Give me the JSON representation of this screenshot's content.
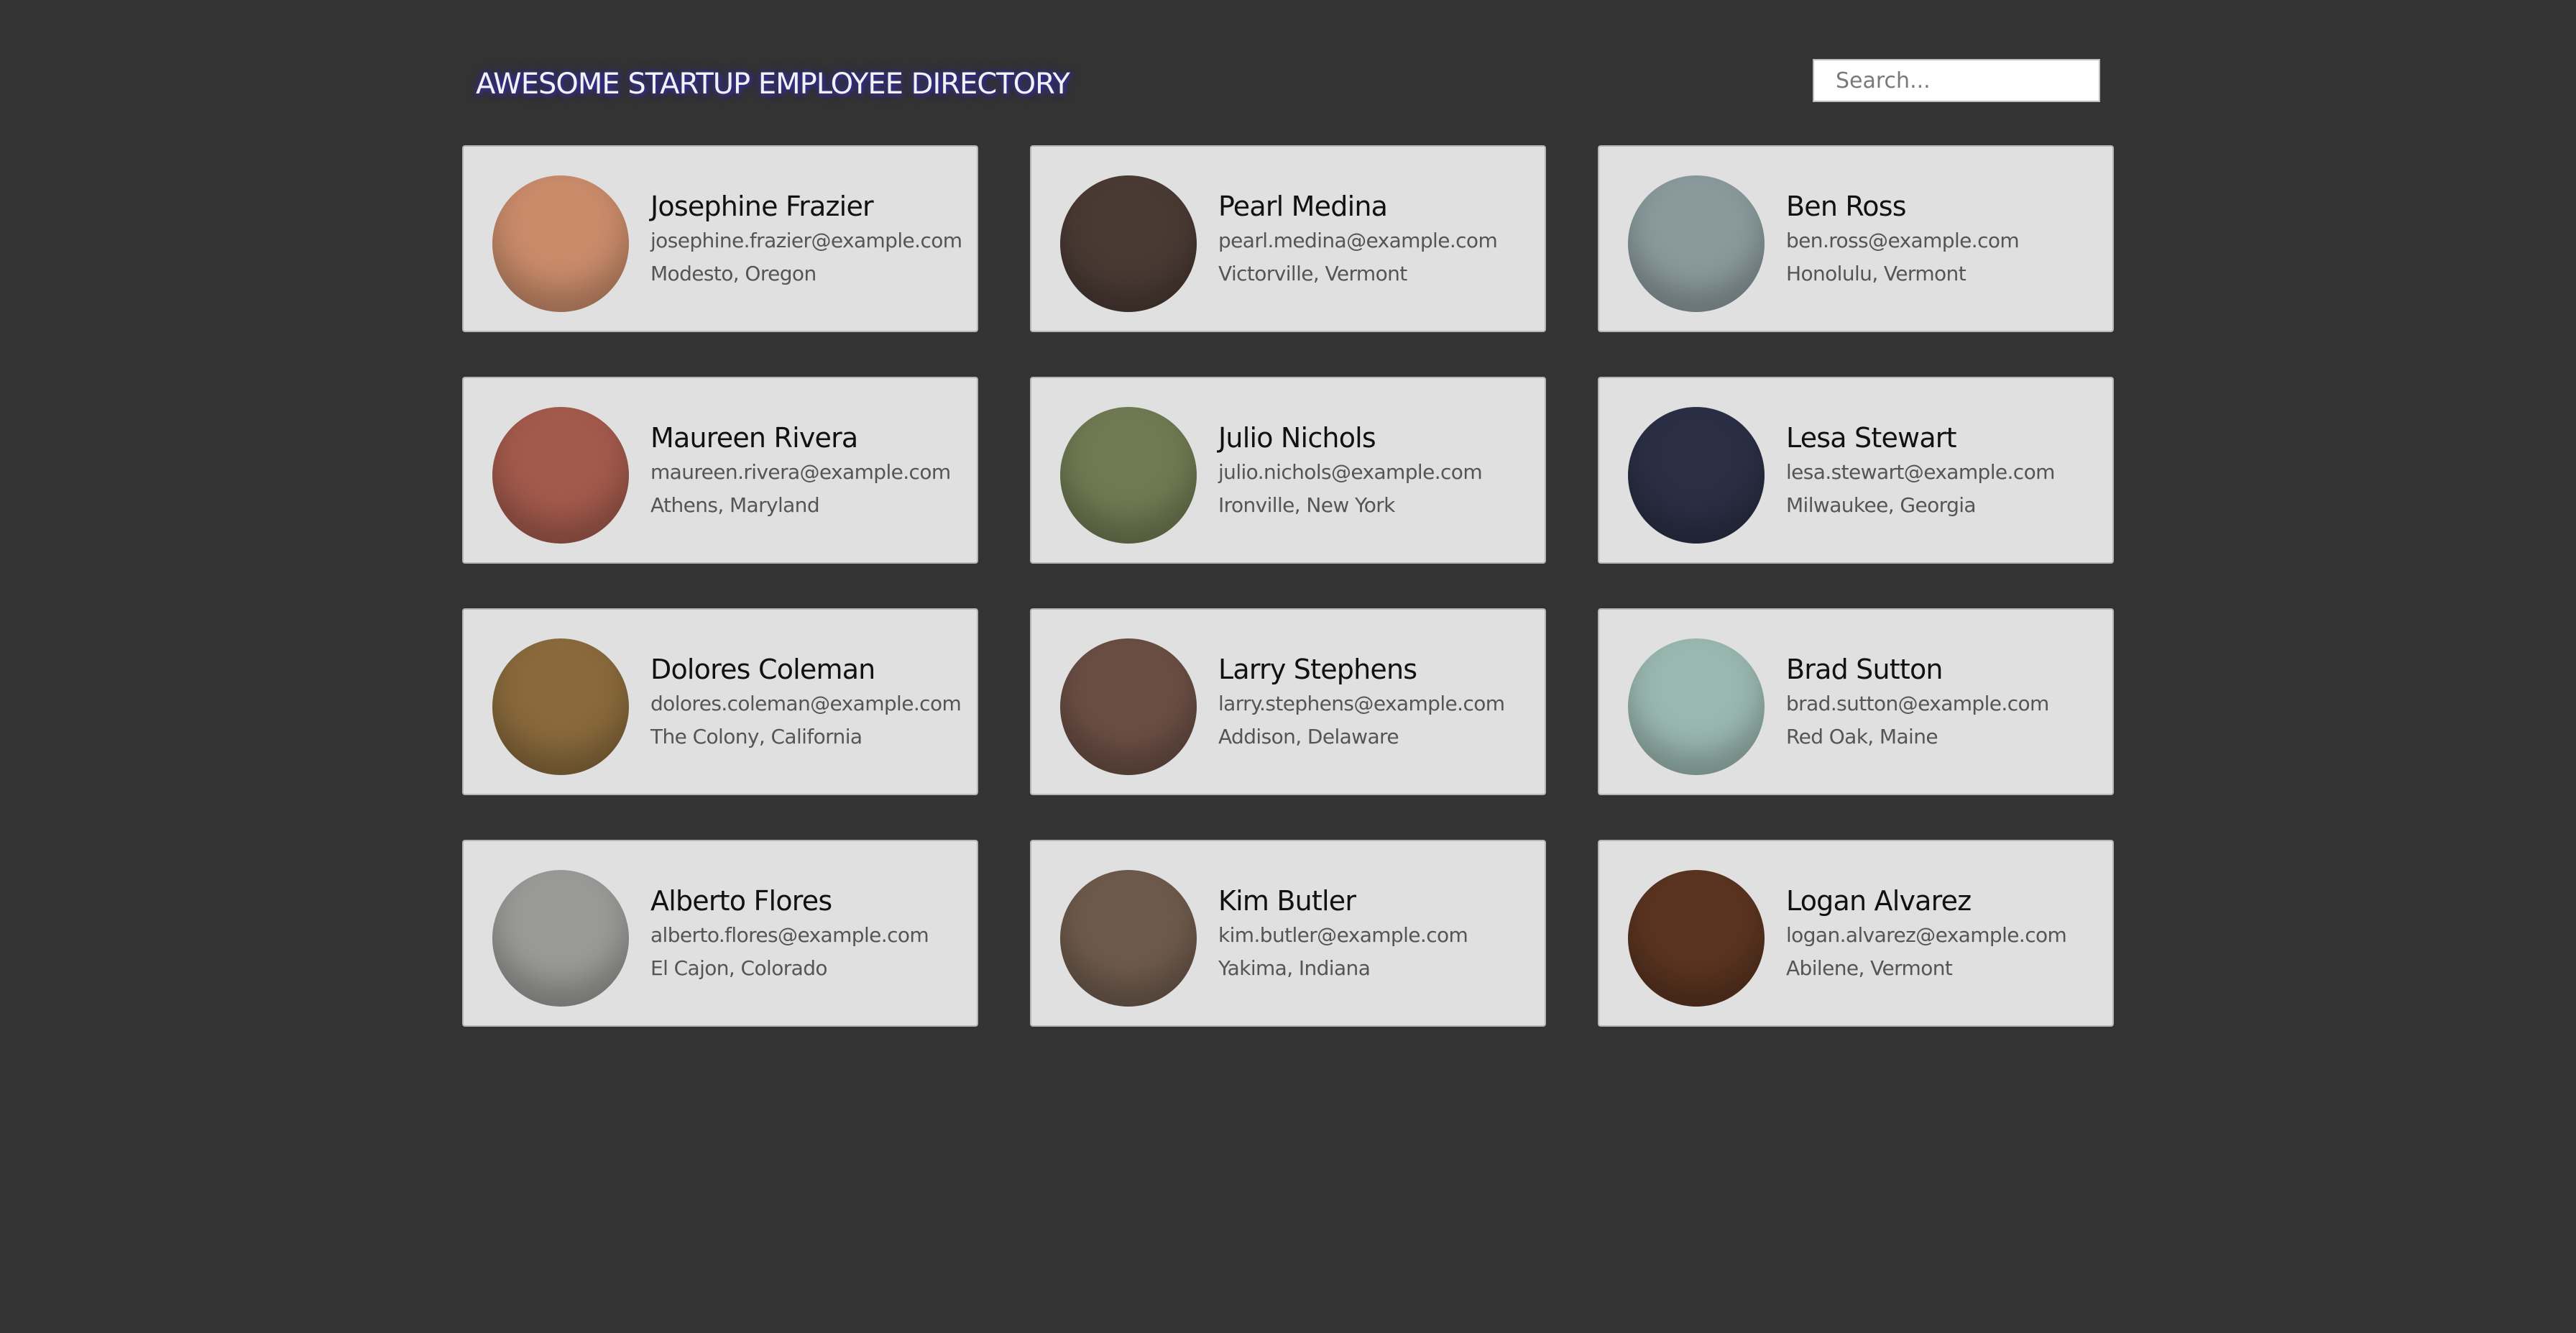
{
  "header": {
    "title": "AWESOME STARTUP EMPLOYEE DIRECTORY",
    "search_placeholder": "Search..."
  },
  "employees": [
    {
      "name": "Josephine Frazier",
      "email": "josephine.frazier@example.com",
      "location": "Modesto, Oregon",
      "avatar_color": "#c98b6a"
    },
    {
      "name": "Pearl Medina",
      "email": "pearl.medina@example.com",
      "location": "Victorville, Vermont",
      "avatar_color": "#4a3a34"
    },
    {
      "name": "Ben Ross",
      "email": "ben.ross@example.com",
      "location": "Honolulu, Vermont",
      "avatar_color": "#8a9a9c"
    },
    {
      "name": "Maureen Rivera",
      "email": "maureen.rivera@example.com",
      "location": "Athens, Maryland",
      "avatar_color": "#a35a4c"
    },
    {
      "name": "Julio Nichols",
      "email": "julio.nichols@example.com",
      "location": "Ironville, New York",
      "avatar_color": "#6f7a52"
    },
    {
      "name": "Lesa Stewart",
      "email": "lesa.stewart@example.com",
      "location": "Milwaukee, Georgia",
      "avatar_color": "#2a2f45"
    },
    {
      "name": "Dolores Coleman",
      "email": "dolores.coleman@example.com",
      "location": "The Colony, California",
      "avatar_color": "#8a6a3c"
    },
    {
      "name": "Larry Stephens",
      "email": "larry.stephens@example.com",
      "location": "Addison, Delaware",
      "avatar_color": "#6a4e44"
    },
    {
      "name": "Brad Sutton",
      "email": "brad.sutton@example.com",
      "location": "Red Oak, Maine",
      "avatar_color": "#9ab8b0"
    },
    {
      "name": "Alberto Flores",
      "email": "alberto.flores@example.com",
      "location": "El Cajon, Colorado",
      "avatar_color": "#9a9a98"
    },
    {
      "name": "Kim Butler",
      "email": "kim.butler@example.com",
      "location": "Yakima, Indiana",
      "avatar_color": "#6e5a4c"
    },
    {
      "name": "Logan Alvarez",
      "email": "logan.alvarez@example.com",
      "location": "Abilene, Vermont",
      "avatar_color": "#5a3420"
    }
  ]
}
